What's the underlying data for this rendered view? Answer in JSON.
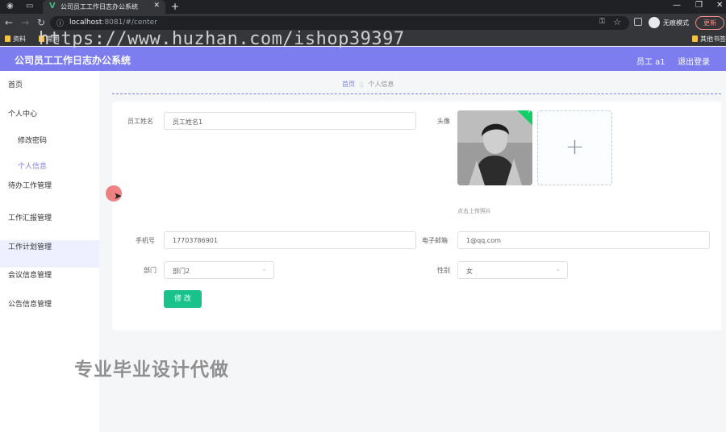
{
  "browser": {
    "tab_title": "公司员工工作日志办公系统",
    "url_host": "localhost",
    "url_rest": ":8081/#/center",
    "incognito_label": "无痕模式",
    "update_label": "更新",
    "bookmarks": [
      "资料",
      "常用",
      "其他书签"
    ],
    "watermark_url": "https://www.huzhan.com/ishop39397"
  },
  "header": {
    "title": "公司员工工作日志办公系统",
    "user": "员工 a1",
    "logout": "退出登录"
  },
  "sidebar": {
    "items": [
      {
        "label": "首页"
      },
      {
        "label": "个人中心"
      },
      {
        "label": "修改密码"
      },
      {
        "label": "个人信息"
      },
      {
        "label": "待办工作管理"
      },
      {
        "label": "工作汇报管理"
      },
      {
        "label": "工作计划管理"
      },
      {
        "label": "会议信息管理"
      },
      {
        "label": "公告信息管理"
      }
    ]
  },
  "breadcrumb": {
    "home": "首页",
    "current": "个人信息"
  },
  "form": {
    "name_label": "员工姓名",
    "name_value": "员工姓名1",
    "avatar_label": "头像",
    "upload_hint": "点击上传照片",
    "phone_label": "手机号",
    "phone_value": "17703786901",
    "email_label": "电子邮箱",
    "email_value": "1@qq.com",
    "dept_label": "部门",
    "dept_value": "部门2",
    "gender_label": "性别",
    "gender_value": "女",
    "submit_label": "修 改"
  },
  "overlay": {
    "watermark_text": "专业毕业设计代做"
  },
  "colors": {
    "accent": "#7d7df0",
    "success": "#19c28a"
  }
}
